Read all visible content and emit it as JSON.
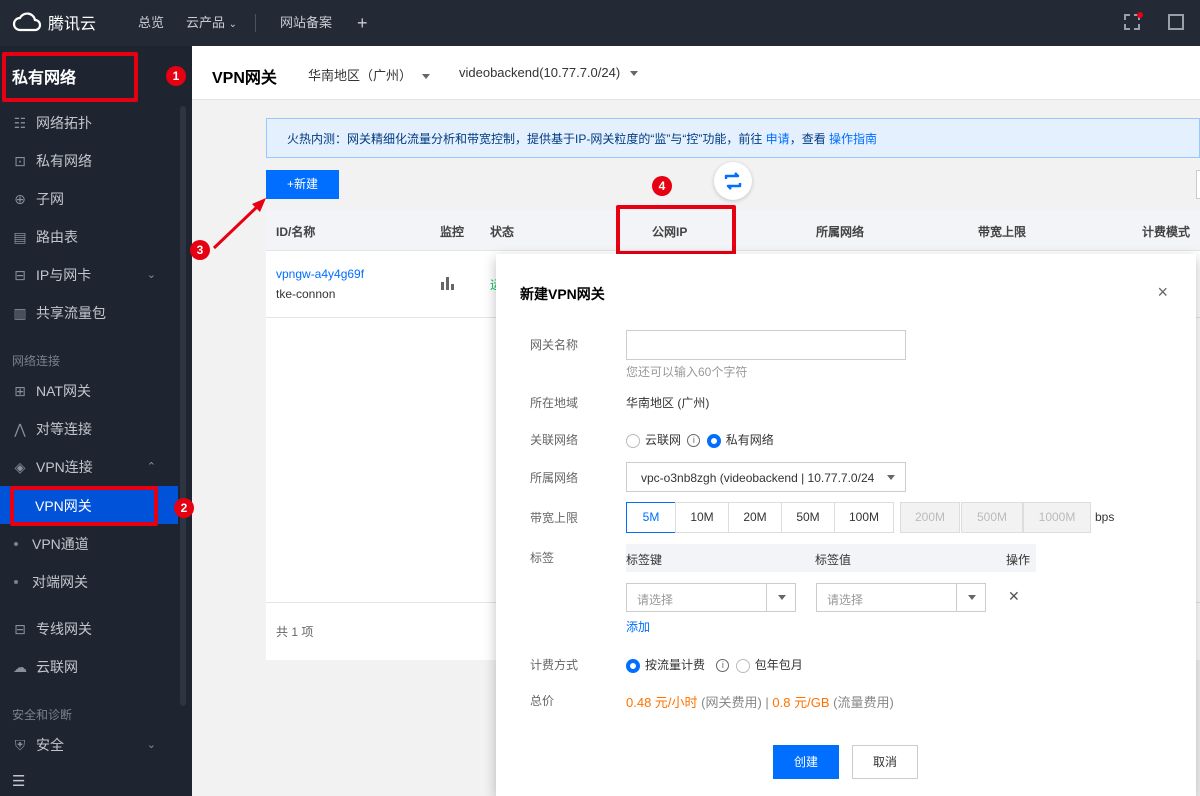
{
  "topbar": {
    "brand": "腾讯云",
    "nav_overview": "总览",
    "nav_products": "云产品",
    "nav_beian": "网站备案",
    "nav_add": "+"
  },
  "sidebar": {
    "title": "私有网络",
    "items": [
      {
        "label": "网络拓扑",
        "icon": "topology-icon"
      },
      {
        "label": "私有网络",
        "icon": "lock-icon"
      },
      {
        "label": "子网",
        "icon": "globe-icon"
      },
      {
        "label": "路由表",
        "icon": "doc-icon"
      },
      {
        "label": "IP与网卡",
        "icon": "nic-icon"
      },
      {
        "label": "共享流量包",
        "icon": "chart-icon"
      }
    ],
    "group_connect": "网络连接",
    "items2": [
      {
        "label": "NAT网关",
        "icon": "nat-icon"
      },
      {
        "label": "对等连接",
        "icon": "peer-icon"
      },
      {
        "label": "VPN连接",
        "icon": "vpn-icon"
      }
    ],
    "subs": [
      "VPN网关",
      "VPN通道",
      "对端网关"
    ],
    "items3": [
      {
        "label": "专线网关",
        "icon": "dc-icon"
      },
      {
        "label": "云联网",
        "icon": "ccn-icon"
      }
    ],
    "group_security": "安全和诊断",
    "item_security": "安全"
  },
  "header": {
    "title": "VPN网关",
    "region": "华南地区（广州）",
    "vpc": "videobackend(10.77.7.0/24)"
  },
  "notice": {
    "text": "火热内测：网关精细化流量分析和带宽控制，提供基于IP-网关粒度的“监”与“控”功能，前往",
    "apply": "申请",
    "mid": "，查看",
    "guide": "操作指南"
  },
  "toolbar": {
    "new_label": "+新建"
  },
  "table": {
    "columns": [
      "ID/名称",
      "监控",
      "状态",
      "公网IP",
      "所属网络",
      "带宽上限",
      "计费模式"
    ],
    "rows": [
      {
        "id": "vpngw-a4y4g69f",
        "name": "tke-connon",
        "status": "运"
      }
    ],
    "footer": "共 1 项"
  },
  "annotations": [
    "1",
    "2",
    "3",
    "4"
  ],
  "modal": {
    "title": "新建VPN网关",
    "close": "×",
    "name_label": "网关名称",
    "name_value": "",
    "name_hint": "您还可以输入60个字符",
    "region_label": "所在地域",
    "region_value": "华南地区 (广州)",
    "assoc_label": "关联网络",
    "assoc_opt1": "云联网",
    "assoc_opt2": "私有网络",
    "vpc_label": "所属网络",
    "vpc_value": "vpc-o3nb8zgh (videobackend | 10.77.7.0/24",
    "bw_label": "带宽上限",
    "bw_options": [
      "5M",
      "10M",
      "20M",
      "50M",
      "100M",
      "200M",
      "500M",
      "1000M"
    ],
    "bw_unit": "bps",
    "tag_label": "标签",
    "tag_key": "标签键",
    "tag_value": "标签值",
    "tag_ops": "操作",
    "tag_placeholder1": "请选择",
    "tag_placeholder2": "请选择",
    "tag_add": "添加",
    "billing_label": "计费方式",
    "billing_opt1": "按流量计费",
    "billing_opt2": "包年包月",
    "price_label": "总价",
    "price1": "0.48 元/小时",
    "price1_note": " (网关费用) | ",
    "price2": "0.8 元/GB",
    "price2_note": " (流量费用)",
    "create": "创建",
    "cancel": "取消"
  },
  "colors": {
    "accent": "#006eff",
    "annotation": "#e60012",
    "price": "#ff7200"
  }
}
